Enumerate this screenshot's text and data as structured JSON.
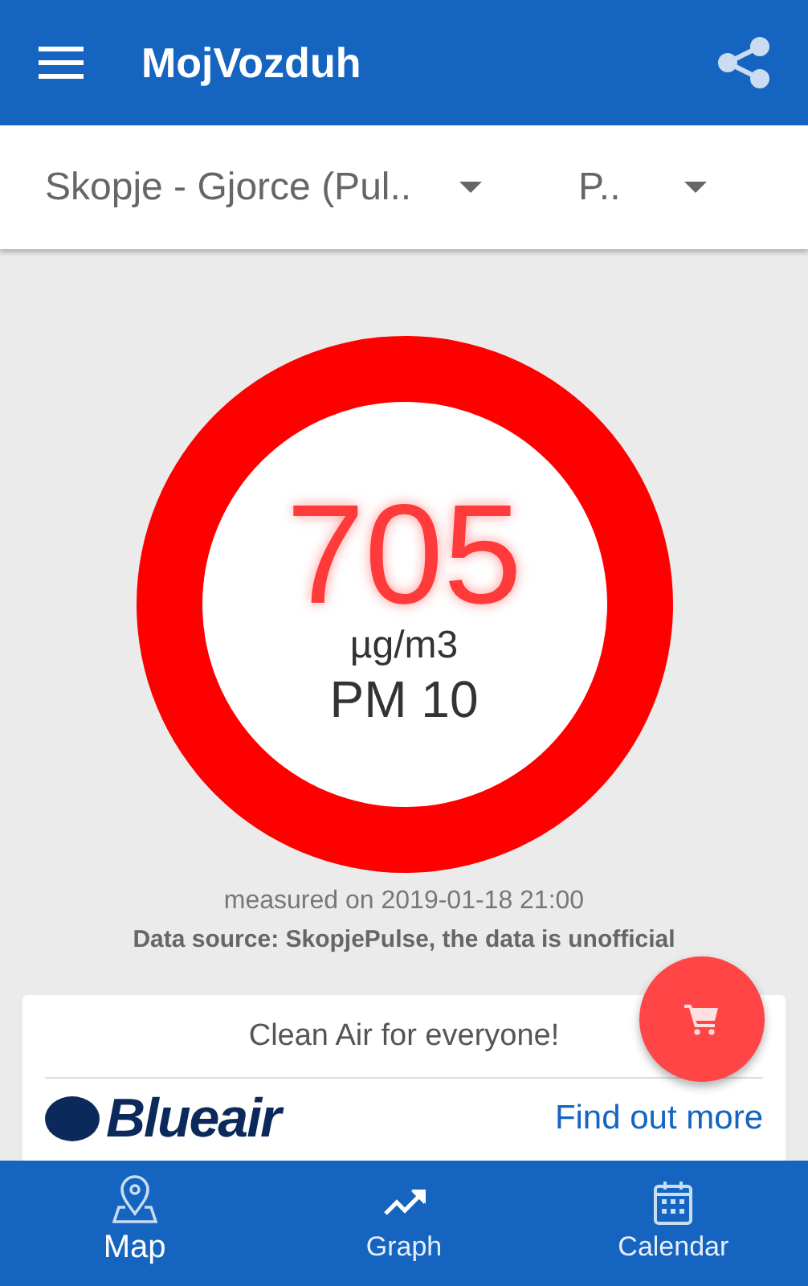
{
  "app_bar": {
    "title": "MojVozduh"
  },
  "selectors": [
    {
      "value": "Skopje - Gjorce (Pul.."
    },
    {
      "value": "P.."
    }
  ],
  "reading": {
    "value": "705",
    "unit": "µg/m3",
    "pollutant": "PM 10"
  },
  "measured": "measured on 2019-01-18 21:00",
  "source": "Data source: SkopjePulse, the data is unofficial",
  "ad": {
    "headline": "Clean Air for everyone!",
    "brand": "Blueair",
    "link": "Find out more"
  },
  "bottom_nav": [
    {
      "label": "Map",
      "kind": "map",
      "selected": true
    },
    {
      "label": "Graph",
      "kind": "graph",
      "selected": false
    },
    {
      "label": "Calendar",
      "kind": "calendar",
      "selected": false
    }
  ]
}
